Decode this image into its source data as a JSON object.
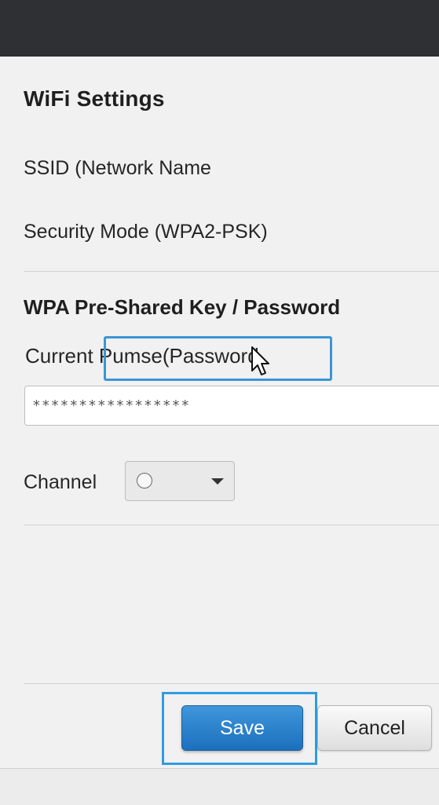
{
  "colors": {
    "topbar": "#2f3033",
    "accent": "#3a95d6",
    "save_button": "#2a82cd"
  },
  "page": {
    "title": "WiFi Settings",
    "ssid_label": "SSID (Network Name",
    "security_mode_label": "Security Mode (WPA2-PSK)"
  },
  "psk_section": {
    "title": "WPA Pre-Shared Key / Password",
    "current_label_prefix": "Current ",
    "current_label_highlighted": "Pumse(Password",
    "password_value": "*****************"
  },
  "channel": {
    "label": "Channel",
    "icon": "radio-circle-icon",
    "dropdown_icon": "dropdown-arrow-icon"
  },
  "actions": {
    "save_label": "Save",
    "cancel_label": "Cancel"
  },
  "cursor": {
    "icon": "mouse-pointer-icon"
  }
}
